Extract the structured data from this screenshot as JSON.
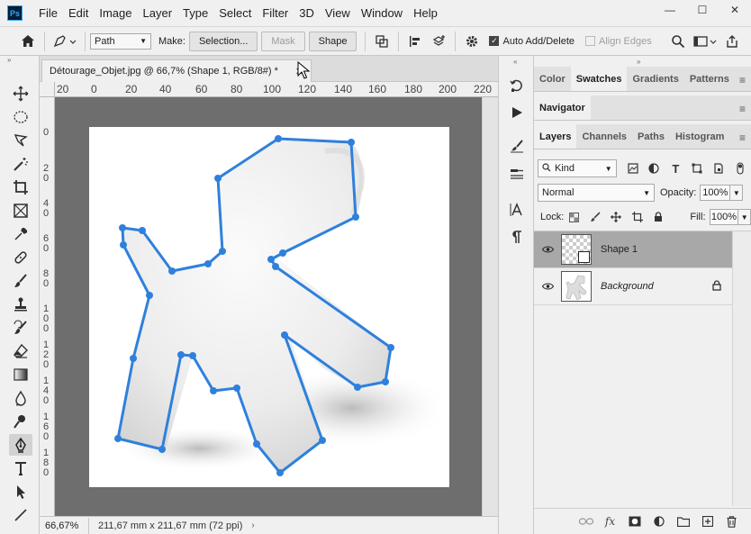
{
  "menu": {
    "items": [
      "File",
      "Edit",
      "Image",
      "Layer",
      "Type",
      "Select",
      "Filter",
      "3D",
      "View",
      "Window",
      "Help"
    ]
  },
  "window_controls": {
    "minimize": "—",
    "maximize": "☐",
    "close": "✕"
  },
  "options": {
    "mode_value": "Path",
    "make_label": "Make:",
    "selection_button": "Selection...",
    "mask_button": "Mask",
    "shape_button": "Shape",
    "auto_add_delete_label": "Auto Add/Delete",
    "auto_add_delete_checked": true,
    "align_edges_label": "Align Edges",
    "align_edges_checked": false
  },
  "document": {
    "tab_title": "Détourage_Objet.jpg @ 66,7% (Shape 1, RGB/8#) *",
    "ruler_h": [
      "20",
      "0",
      "20",
      "40",
      "60",
      "80",
      "100",
      "120",
      "140",
      "160",
      "180",
      "200",
      "220"
    ],
    "ruler_v": [
      "0",
      "2",
      "0",
      "4",
      "0",
      "6",
      "0",
      "8",
      "0",
      "1",
      "0",
      "0",
      "1",
      "2",
      "0",
      "1",
      "4",
      "0",
      "1",
      "6",
      "0",
      "1",
      "8",
      "0"
    ],
    "zoom": "66,67%",
    "doc_size": "211,67 mm x 211,67 mm (72 ppi)"
  },
  "panels": {
    "top_tabs": [
      "Color",
      "Swatches",
      "Gradients",
      "Patterns"
    ],
    "top_active": "Swatches",
    "navigator_tab": "Navigator",
    "layers_tabs": [
      "Layers",
      "Channels",
      "Paths",
      "Histogram"
    ],
    "layers_active": "Layers",
    "filter_kind": "Kind",
    "blend_mode": "Normal",
    "opacity_label": "Opacity:",
    "opacity_value": "100%",
    "lock_label": "Lock:",
    "fill_label": "Fill:",
    "fill_value": "100%",
    "layers": [
      {
        "name": "Shape 1",
        "selected": true,
        "locked": false
      },
      {
        "name": "Background",
        "selected": false,
        "locked": true
      }
    ]
  },
  "colors": {
    "path_stroke": "#2f80dc",
    "canvas_bg": "#6e6e6e",
    "selected_layer": "#a8a8a8"
  }
}
